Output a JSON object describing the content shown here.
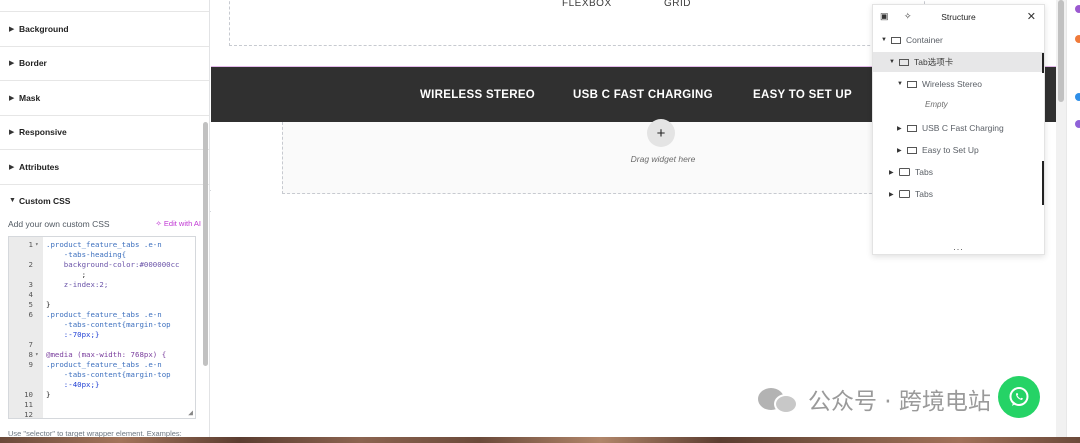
{
  "left_panel": {
    "sections": [
      {
        "label": "Background"
      },
      {
        "label": "Border"
      },
      {
        "label": "Mask"
      },
      {
        "label": "Responsive"
      },
      {
        "label": "Attributes"
      }
    ],
    "custom_css": {
      "label": "Custom CSS",
      "description": "Add your own custom CSS",
      "ai_button": "Edit with AI",
      "lines": [
        {
          "n": "1",
          "fold": "▾",
          "text": ".product_feature_tabs .e-n",
          "cls": "c-sel"
        },
        {
          "n": "",
          "fold": "",
          "text": "    -tabs-heading{",
          "cls": "c-sel"
        },
        {
          "n": "2",
          "fold": "",
          "text": "    background-color:#000000cc",
          "cls": "c-prop"
        },
        {
          "n": "",
          "fold": "",
          "text": "        ;",
          "cls": "c-blk"
        },
        {
          "n": "3",
          "fold": "",
          "text": "    z-index:2;",
          "cls": "c-prop"
        },
        {
          "n": "4",
          "fold": "",
          "text": "",
          "cls": "c-blk"
        },
        {
          "n": "5",
          "fold": "",
          "text": "}",
          "cls": "c-blk"
        },
        {
          "n": "6",
          "fold": "",
          "text": ".product_feature_tabs .e-n",
          "cls": "c-sel"
        },
        {
          "n": "",
          "fold": "",
          "text": "    -tabs-content{margin-top",
          "cls": "c-sel"
        },
        {
          "n": "",
          "fold": "",
          "text": "    :-70px;}",
          "cls": "c-val"
        },
        {
          "n": "7",
          "fold": "",
          "text": "",
          "cls": "c-blk"
        },
        {
          "n": "8",
          "fold": "▾",
          "text": "@media (max-width: 768px) {",
          "cls": "c-kw"
        },
        {
          "n": "9",
          "fold": "",
          "text": ".product_feature_tabs .e-n",
          "cls": "c-sel"
        },
        {
          "n": "",
          "fold": "",
          "text": "    -tabs-content{margin-top",
          "cls": "c-sel"
        },
        {
          "n": "",
          "fold": "",
          "text": "    :-40px;}",
          "cls": "c-val"
        },
        {
          "n": "10",
          "fold": "",
          "text": "}",
          "cls": "c-blk"
        },
        {
          "n": "11",
          "fold": "",
          "text": "",
          "cls": "c-blk"
        },
        {
          "n": "12",
          "fold": "",
          "text": "",
          "cls": "c-blk"
        }
      ]
    },
    "bottom_hint": "Use \"selector\" to target wrapper element. Examples:",
    "collapse_icon": "‹"
  },
  "canvas": {
    "layout_options": [
      "FLEXBOX",
      "GRID"
    ],
    "tabs": [
      "WIRELESS STEREO",
      "USB C FAST CHARGING",
      "EASY TO SET UP"
    ],
    "add_icon": "+",
    "drag_text": "Drag widget here"
  },
  "structure": {
    "title": "Structure",
    "close_icon": "✕",
    "items": [
      {
        "label": "Container",
        "arrow": "▼",
        "icon": "box"
      },
      {
        "label": "Tab选项卡",
        "arrow": "▼",
        "icon": "box",
        "selected": true
      },
      {
        "label": "Wireless Stereo",
        "arrow": "▼",
        "icon": "box"
      },
      {
        "label": "USB C Fast Charging",
        "arrow": "▶",
        "icon": "box"
      },
      {
        "label": "Easy to Set Up",
        "arrow": "▶",
        "icon": "box"
      },
      {
        "label": "Tabs",
        "arrow": "▶",
        "icon": "folder"
      },
      {
        "label": "Tabs",
        "arrow": "▶",
        "icon": "folder"
      }
    ],
    "empty_label": "Empty",
    "more_label": "..."
  },
  "watermark": {
    "text": "公众号 · 跨境电站"
  },
  "colors": {
    "tabs_bar": "#303030",
    "accent_purple": "#c036d4",
    "whatsapp": "#25d366"
  }
}
